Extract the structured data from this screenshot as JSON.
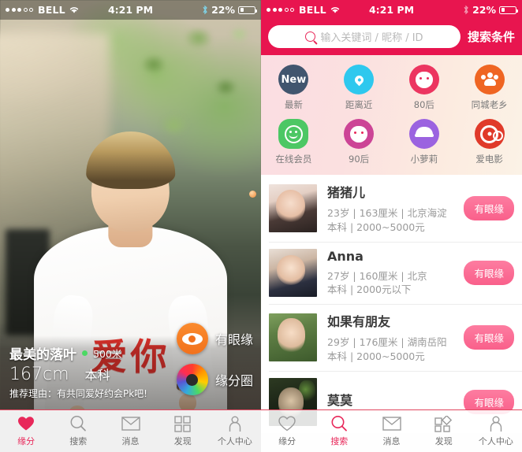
{
  "status_bar": {
    "signal_dots": 5,
    "signal_filled": 3,
    "carrier": "BELL",
    "wifi_icon": "wifi-icon",
    "time": "4:21 PM",
    "bluetooth_icon": "bluetooth-icon",
    "battery_percent": "22%"
  },
  "left_screen": {
    "profile": {
      "name": "最美的落叶",
      "online_dot_color": "#4cd964",
      "distance": "500米",
      "height": "167cm",
      "education": "本科",
      "reason": "推荐理由：有共同爱好约会Pk吧!"
    },
    "actions": [
      {
        "label": "有眼缘",
        "icon": "eye-icon",
        "color": "#f2711c"
      },
      {
        "label": "缘分圈",
        "icon": "rainbow-ring-icon",
        "color": "#rainbow"
      }
    ],
    "shirt_text": "爱你",
    "tabs": [
      {
        "label": "缘分",
        "icon": "heart-icon",
        "active": true
      },
      {
        "label": "搜索",
        "icon": "search-icon",
        "active": false
      },
      {
        "label": "消息",
        "icon": "envelope-icon",
        "active": false
      },
      {
        "label": "发现",
        "icon": "grid-icon",
        "active": false
      },
      {
        "label": "个人中心",
        "icon": "person-icon",
        "active": false
      }
    ]
  },
  "right_screen": {
    "search": {
      "placeholder": "输入关键词 / 昵称 / ID",
      "icon": "search-icon",
      "condition_label": "搜索条件"
    },
    "categories": [
      {
        "label": "最新",
        "icon": "new-badge-icon",
        "color": "#41556e",
        "glyph": "New"
      },
      {
        "label": "距离近",
        "icon": "location-pin-icon",
        "color": "#2ec8ee",
        "glyph": ""
      },
      {
        "label": "80后",
        "icon": "girl-face-icon",
        "color": "#ec3560",
        "glyph": ""
      },
      {
        "label": "同城老乡",
        "icon": "group-people-icon",
        "color": "#ef6522",
        "glyph": ""
      },
      {
        "label": "在线会员",
        "icon": "smiley-icon",
        "color": "#4cc764",
        "glyph": ""
      },
      {
        "label": "90后",
        "icon": "pink-girl-icon",
        "color": "#cc4496",
        "glyph": ""
      },
      {
        "label": "小萝莉",
        "icon": "loli-hat-icon",
        "color": "#9b63e0",
        "glyph": ""
      },
      {
        "label": "爱电影",
        "icon": "film-reel-icon",
        "color": "#e03a2a",
        "glyph": ""
      }
    ],
    "list": [
      {
        "name": "猪猪儿",
        "meta_line1": "23岁 | 163厘米 | 北京海淀",
        "meta_line2": "本科 | 2000~5000元",
        "button": "有眼缘",
        "avatar": "avatar-zhuzhuer"
      },
      {
        "name": "Anna",
        "meta_line1": "27岁 | 160厘米 | 北京",
        "meta_line2": "本科 | 2000元以下",
        "button": "有眼缘",
        "avatar": "avatar-anna"
      },
      {
        "name": "如果有朋友",
        "meta_line1": "29岁 | 176厘米 | 湖南岳阳",
        "meta_line2": "本科 | 2000~5000元",
        "button": "有眼缘",
        "avatar": "avatar-ruguoyoupengyou"
      },
      {
        "name": "莫莫",
        "meta_line1": "",
        "meta_line2": "",
        "button": "有眼缘",
        "avatar": "avatar-momo"
      }
    ],
    "tabs": [
      {
        "label": "缘分",
        "icon": "heart-icon",
        "active": false
      },
      {
        "label": "搜索",
        "icon": "search-icon",
        "active": true
      },
      {
        "label": "消息",
        "icon": "envelope-icon",
        "active": false
      },
      {
        "label": "发现",
        "icon": "grid-diamond-icon",
        "active": false
      },
      {
        "label": "个人中心",
        "icon": "person-icon",
        "active": false
      }
    ]
  },
  "colors": {
    "brand_pink": "#e8154f",
    "accent_pink": "#e8285a",
    "like_button": "#f9608b",
    "orange": "#f2711c"
  }
}
